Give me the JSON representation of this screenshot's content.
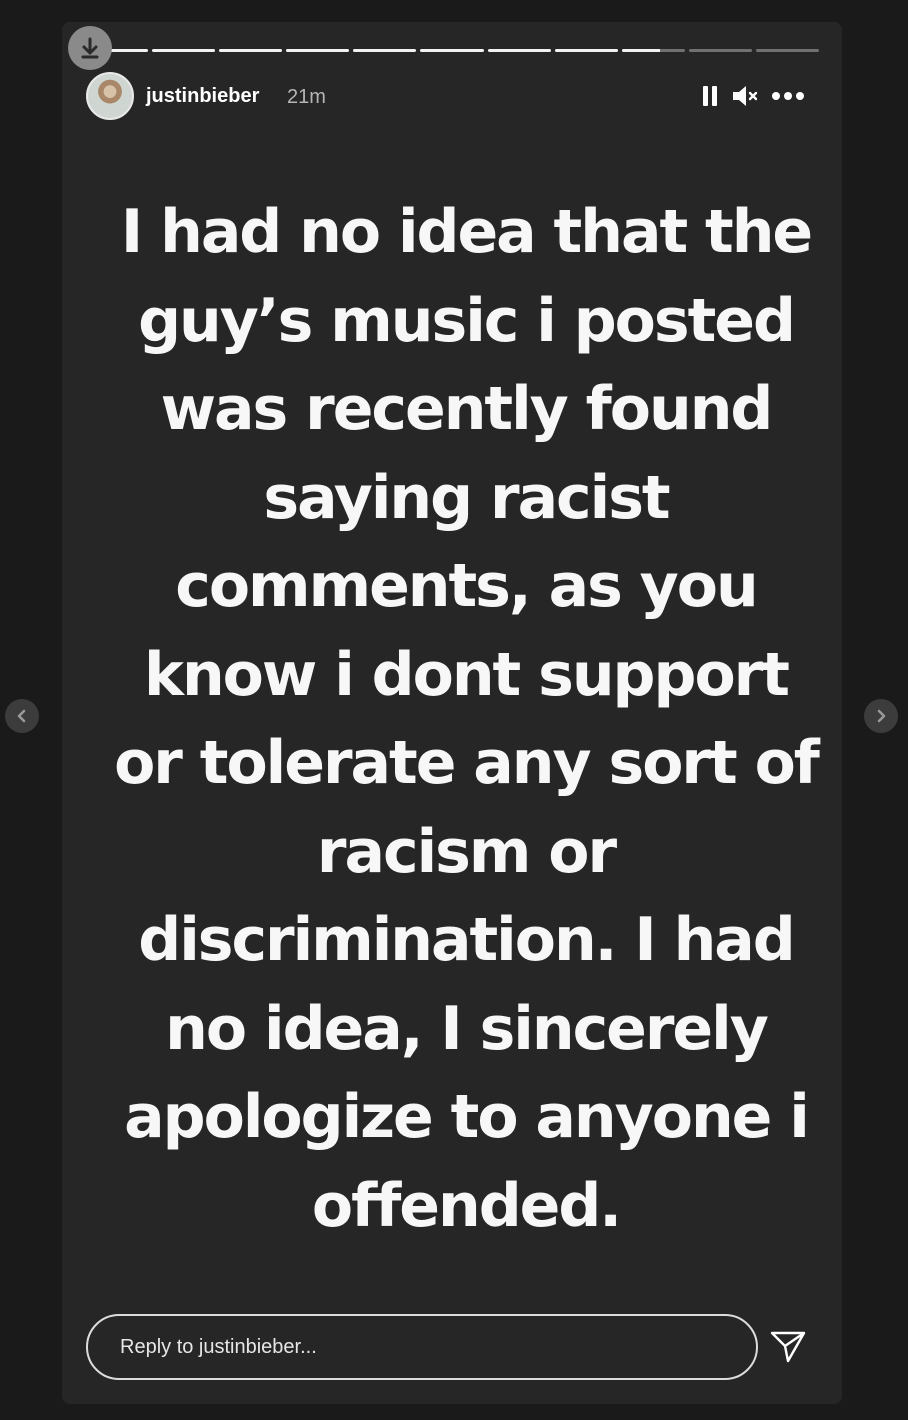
{
  "story": {
    "username": "justinbieber",
    "time": "21m",
    "progress": [
      1,
      1,
      1,
      1,
      1,
      1,
      1,
      1,
      0.6,
      0,
      0
    ],
    "caption": "I had no idea that the\nguy’s music i posted\nwas recently found\nsaying  racist\ncomments, as you\nknow i dont support\nor tolerate any sort of\nracism or\ndiscrimination. I had\nno idea, I sincerely\napologize to anyone i\noffended."
  },
  "controls": {
    "pause_icon": "pause-icon",
    "mute_icon": "mute-icon",
    "more_icon": "more-options-icon",
    "download_icon": "download-icon",
    "prev_icon": "chevron-left-icon",
    "next_icon": "chevron-right-icon",
    "send_icon": "send-icon"
  },
  "reply": {
    "placeholder": "Reply to justinbieber..."
  },
  "colors": {
    "page_background": "#1a1a1a",
    "story_background": "#262626",
    "text": "#ffffff",
    "muted_text": "#b5b5b5"
  }
}
